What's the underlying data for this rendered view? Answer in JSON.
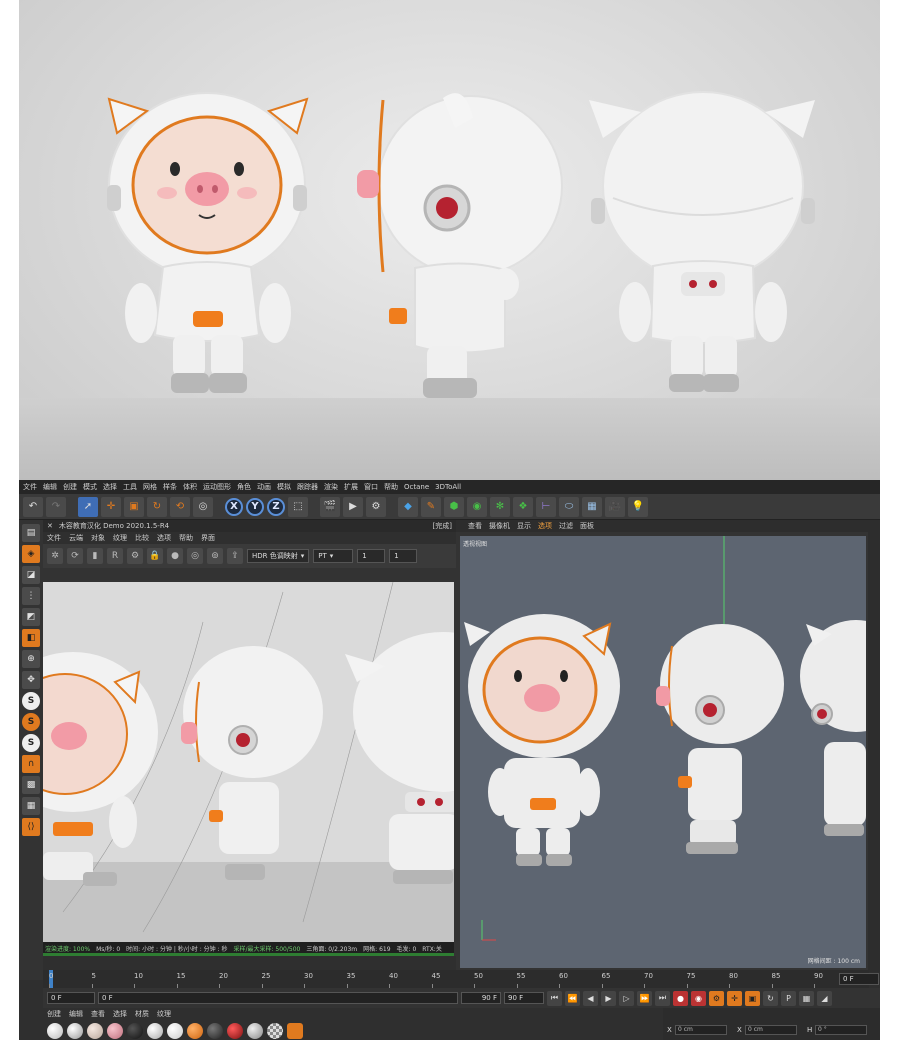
{
  "menu_items": [
    "文件",
    "编辑",
    "创建",
    "模式",
    "选择",
    "工具",
    "网格",
    "样条",
    "体积",
    "运动图形",
    "角色",
    "动画",
    "模拟",
    "跟踪器",
    "渲染",
    "扩展",
    "窗口",
    "帮助",
    "Octane",
    "3DToAll"
  ],
  "picture_viewer": {
    "title": "木容教育汉化 Demo 2020.1.5-R4",
    "menu": [
      "文件",
      "云端",
      "对象",
      "纹理",
      "比较",
      "选项",
      "帮助",
      "界面"
    ],
    "status_text": "[完成]",
    "mode_select": "HDR 色调映射",
    "pt_select": "PT",
    "pass_value": "1",
    "pass_value2": "1",
    "status_bar": {
      "progress": "渲染进度: 100%",
      "ms": "Ms/秒: 0",
      "time": "时间: 小时 : 分钟 | 秒/小时 : 分钟 : 秒",
      "samples": "采样/最大采样: 500/500",
      "triangles": "三角面: 0/2.203m",
      "mesh": "网格: 619",
      "hair": "毛发: 0",
      "rtx": "RTX:关"
    }
  },
  "viewport": {
    "menu": [
      "查看",
      "摄像机",
      "显示",
      "选项",
      "过滤",
      "面板"
    ],
    "active_menu": "选项",
    "label": "透视视图",
    "grid_label": "网格间距 : 100 cm"
  },
  "timeline": {
    "ticks": [
      "0",
      "5",
      "10",
      "15",
      "20",
      "25",
      "30",
      "35",
      "40",
      "45",
      "50",
      "55",
      "60",
      "65",
      "70",
      "75",
      "80",
      "85",
      "90"
    ],
    "current_frame": "0 F",
    "end_field": "0 F"
  },
  "transport": {
    "start": "0 F",
    "current": "0 F",
    "end": "90 F",
    "end2": "90 F"
  },
  "material": {
    "menu": [
      "创建",
      "编辑",
      "查看",
      "选择",
      "材质",
      "纹理"
    ]
  },
  "coordinates": {
    "x_label": "X",
    "x_value": "0 cm",
    "y_label": "X",
    "y_value": "0 cm",
    "h_label": "H",
    "h_value": "0 °"
  }
}
